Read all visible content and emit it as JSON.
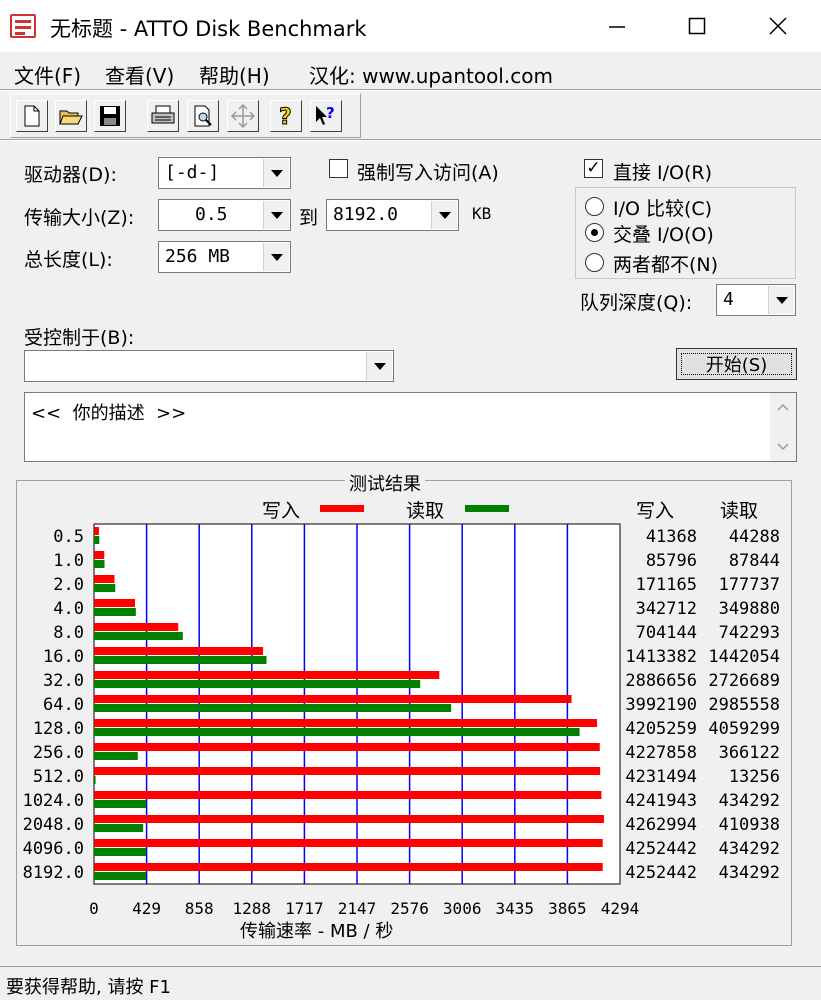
{
  "window": {
    "title": "无标题 - ATTO Disk Benchmark",
    "controls": {
      "minimize": "—",
      "maximize": "☐",
      "close": "✕"
    }
  },
  "menu": [
    {
      "label": "文件(F)"
    },
    {
      "label": "查看(V)"
    },
    {
      "label": "帮助(H)"
    },
    {
      "label": "汉化: www.upantool.com"
    }
  ],
  "toolbar": {
    "icons": [
      "new-file-icon",
      "open-folder-icon",
      "save-icon",
      "print-icon",
      "print-preview-icon",
      "move-icon",
      "help-icon",
      "context-help-icon"
    ]
  },
  "settings": {
    "drive_label": "驱动器(D):",
    "drive_value": "[-d-]",
    "transfer_label": "传输大小(Z):",
    "transfer_from": "0.5",
    "transfer_to_label": "到",
    "transfer_to": "8192.0",
    "transfer_unit": "KB",
    "total_label": "总长度(L):",
    "total_value": "256 MB",
    "force_write_label": "强制写入访问(A)",
    "force_write_checked": false,
    "direct_io_label": "直接 I/O(R)",
    "direct_io_checked": true,
    "io_compare_label": "I/O 比较(C)",
    "overlapped_io_label": "交叠 I/O(O)",
    "neither_label": "两者都不(N)",
    "selected_radio": "overlapped",
    "queue_depth_label": "队列深度(Q):",
    "queue_depth_value": "4",
    "controlled_by_label": "受控制于(B):",
    "controlled_by_value": "",
    "start_button": "开始(S)",
    "description": "<<  你的描述  >>"
  },
  "results": {
    "group_title": "测试结果",
    "legend_write": "写入",
    "legend_read": "读取",
    "col_write": "写入",
    "col_read": "读取",
    "write_color": "#ff0000",
    "read_color": "#008000",
    "grid_color": "#0000ff",
    "xlabel": "传输速率 - MB / 秒",
    "x_ticks": [
      "0",
      "429",
      "858",
      "1288",
      "1717",
      "2147",
      "2576",
      "3006",
      "3435",
      "3865",
      "4294"
    ]
  },
  "chart_data": {
    "type": "bar",
    "orientation": "horizontal",
    "title": "测试结果",
    "xlabel": "传输速率 - MB / 秒",
    "xlim": [
      0,
      4294
    ],
    "grid": true,
    "legend": "top",
    "categories": [
      "0.5",
      "1.0",
      "2.0",
      "4.0",
      "8.0",
      "16.0",
      "32.0",
      "64.0",
      "128.0",
      "256.0",
      "512.0",
      "1024.0",
      "2048.0",
      "4096.0",
      "8192.0"
    ],
    "series": [
      {
        "name": "写入",
        "color": "#ff0000",
        "values": [
          41368,
          85796,
          171165,
          342712,
          704144,
          1413382,
          2886656,
          3992190,
          4205259,
          4227858,
          4231494,
          4241943,
          4262994,
          4252442,
          4252442
        ],
        "display": [
          "41368",
          "85796",
          "171165",
          "342712",
          "704144",
          "1413382",
          "2886656",
          "3992190",
          "4205259",
          "4227858",
          "4231494",
          "4241943",
          "4262994",
          "4252442",
          "4252442"
        ]
      },
      {
        "name": "读取",
        "color": "#008000",
        "values": [
          44288,
          87844,
          177737,
          349880,
          742293,
          1442054,
          2726689,
          2985558,
          4059299,
          366122,
          13256,
          434292,
          410938,
          434292,
          434292
        ],
        "display": [
          "44288",
          "87844",
          "177737",
          "349880",
          "742293",
          "1442054",
          "2726689",
          "2985558",
          "4059299",
          "366122",
          "13256",
          "434292",
          "410938",
          "434292",
          "434292"
        ]
      }
    ]
  },
  "status": {
    "text": "要获得帮助, 请按 F1"
  }
}
